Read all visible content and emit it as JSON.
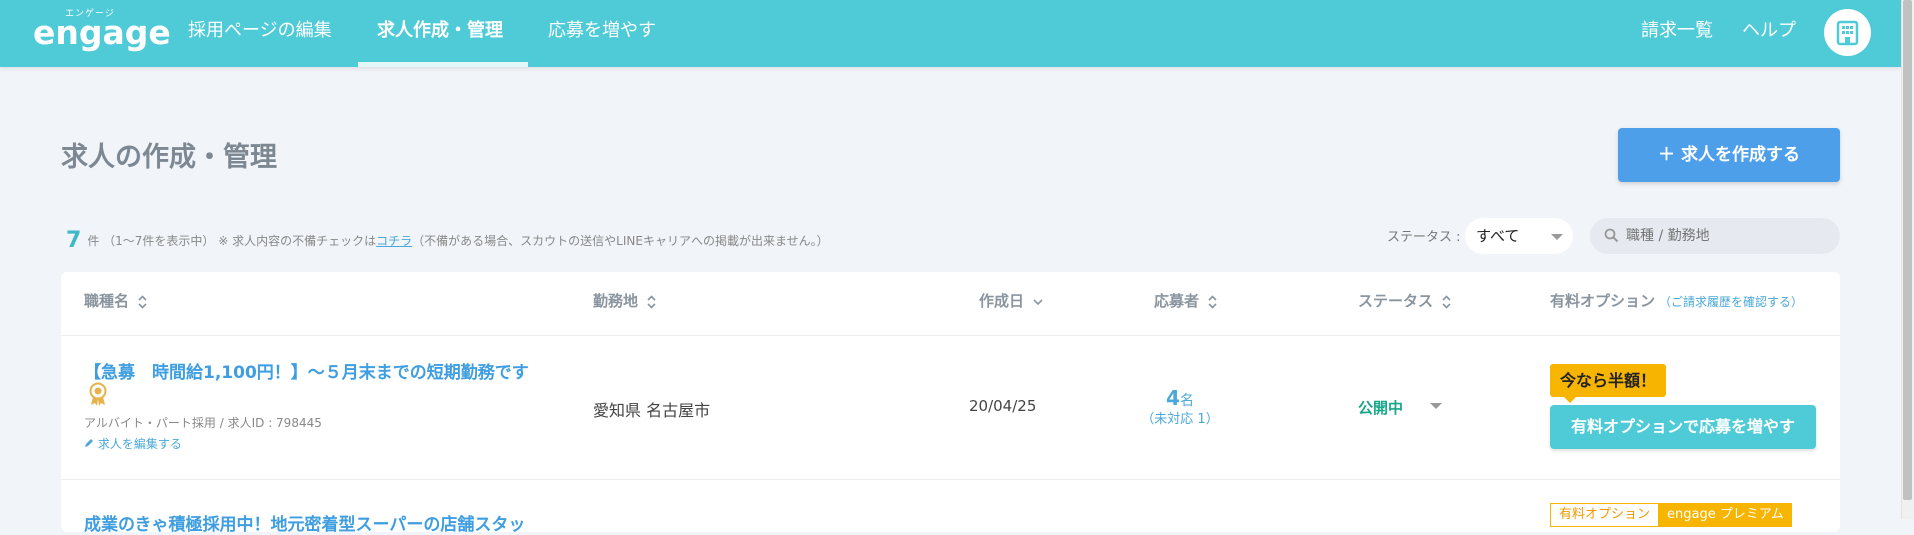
{
  "header": {
    "logo_ruby": "エンゲージ",
    "logo_text": "engage",
    "nav": [
      {
        "label": "採用ページの編集"
      },
      {
        "label": "求人作成・管理"
      },
      {
        "label": "応募を増やす"
      }
    ],
    "right_links": [
      {
        "label": "請求一覧"
      },
      {
        "label": "ヘルプ"
      }
    ],
    "account_icon": "building-icon",
    "accent_color": "#4ecbd6"
  },
  "page": {
    "title": "求人の作成・管理",
    "create_button": "＋ 求人を作成する"
  },
  "summary": {
    "count": "7",
    "unit": "件",
    "range": "（1〜7件を表示中）",
    "note_prefix": "※ 求人内容の不備チェックは",
    "note_link": "コチラ",
    "note_suffix": "（不備がある場合、スカウトの送信やLINEキャリアへの掲載が出来ません。）"
  },
  "filters": {
    "status_label": "ステータス :",
    "status_value": "すべて",
    "search_placeholder": "職種 / 勤務地"
  },
  "table": {
    "headers": {
      "job": "職種名",
      "location": "勤務地",
      "created": "作成日",
      "applicants": "応募者",
      "status": "ステータス",
      "option": "有料オプション",
      "option_link": "（ご請求履歴を確認する）"
    },
    "rows": [
      {
        "title": "【急募　時間給1,100円！】〜５月末までの短期勤務です",
        "employment": "アルバイト・パート採用",
        "separator": "/",
        "job_id": "求人ID : 798445",
        "edit": "求人を編集する",
        "location": "愛知県 名古屋市",
        "created": "20/04/25",
        "applicants_count": "4",
        "applicants_unit": "名",
        "applicants_unhandled": "（未対応 1）",
        "status": "公開中",
        "promo_badge": "今なら半額！",
        "option_button": "有料オプションで応募を増やす"
      },
      {
        "title": "成業のきゃ積極採用中！地元密着型スーパーの店舗スタッ",
        "tag_option": "有料オプション",
        "tag_premium": "engage プレミアム"
      }
    ]
  }
}
